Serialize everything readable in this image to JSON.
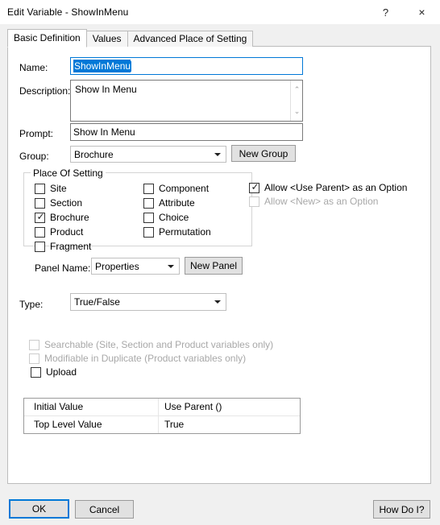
{
  "window": {
    "title": "Edit Variable - ShowInMenu",
    "help_button": "?",
    "close_button": "×"
  },
  "tabs": [
    {
      "label": "Basic Definition",
      "active": true
    },
    {
      "label": "Values",
      "active": false
    },
    {
      "label": "Advanced Place of Setting",
      "active": false
    }
  ],
  "fields": {
    "name_label": "Name:",
    "name_value": "ShowInMenu",
    "description_label": "Description:",
    "description_value": "Show In Menu",
    "prompt_label": "Prompt:",
    "prompt_value": "Show In Menu",
    "group_label": "Group:",
    "group_value": "Brochure",
    "new_group_button": "New Group",
    "type_label": "Type:",
    "type_value": "True/False"
  },
  "place_of_setting": {
    "title": "Place Of Setting",
    "column1": [
      {
        "label": "Site",
        "checked": false
      },
      {
        "label": "Section",
        "checked": false
      },
      {
        "label": "Brochure",
        "checked": true
      },
      {
        "label": "Product",
        "checked": false
      },
      {
        "label": "Fragment",
        "checked": false
      }
    ],
    "column2": [
      {
        "label": "Component",
        "checked": false
      },
      {
        "label": "Attribute",
        "checked": false
      },
      {
        "label": "Choice",
        "checked": false
      },
      {
        "label": "Permutation",
        "checked": false
      }
    ],
    "panel_name_label": "Panel Name:",
    "panel_name_value": "Properties",
    "new_panel_button": "New Panel"
  },
  "options": [
    {
      "label": "Allow <Use Parent> as an Option",
      "checked": true,
      "disabled": false
    },
    {
      "label": "Allow <New> as an Option",
      "checked": false,
      "disabled": true
    }
  ],
  "flags": [
    {
      "label": "Searchable (Site, Section and Product variables only)",
      "checked": false,
      "disabled": true
    },
    {
      "label": "Modifiable in Duplicate (Product variables only)",
      "checked": false,
      "disabled": true
    },
    {
      "label": "Upload",
      "checked": false,
      "disabled": false
    }
  ],
  "values_table": {
    "rows": [
      {
        "key": "Initial Value",
        "value": "Use Parent ()"
      },
      {
        "key": "Top Level Value",
        "value": "True"
      }
    ]
  },
  "footer": {
    "ok_button": "OK",
    "cancel_button": "Cancel",
    "how_do_i_button": "How Do I?"
  },
  "icons": {
    "scroll_up": "⌃",
    "scroll_down": "⌄",
    "checkmark": "✓"
  }
}
